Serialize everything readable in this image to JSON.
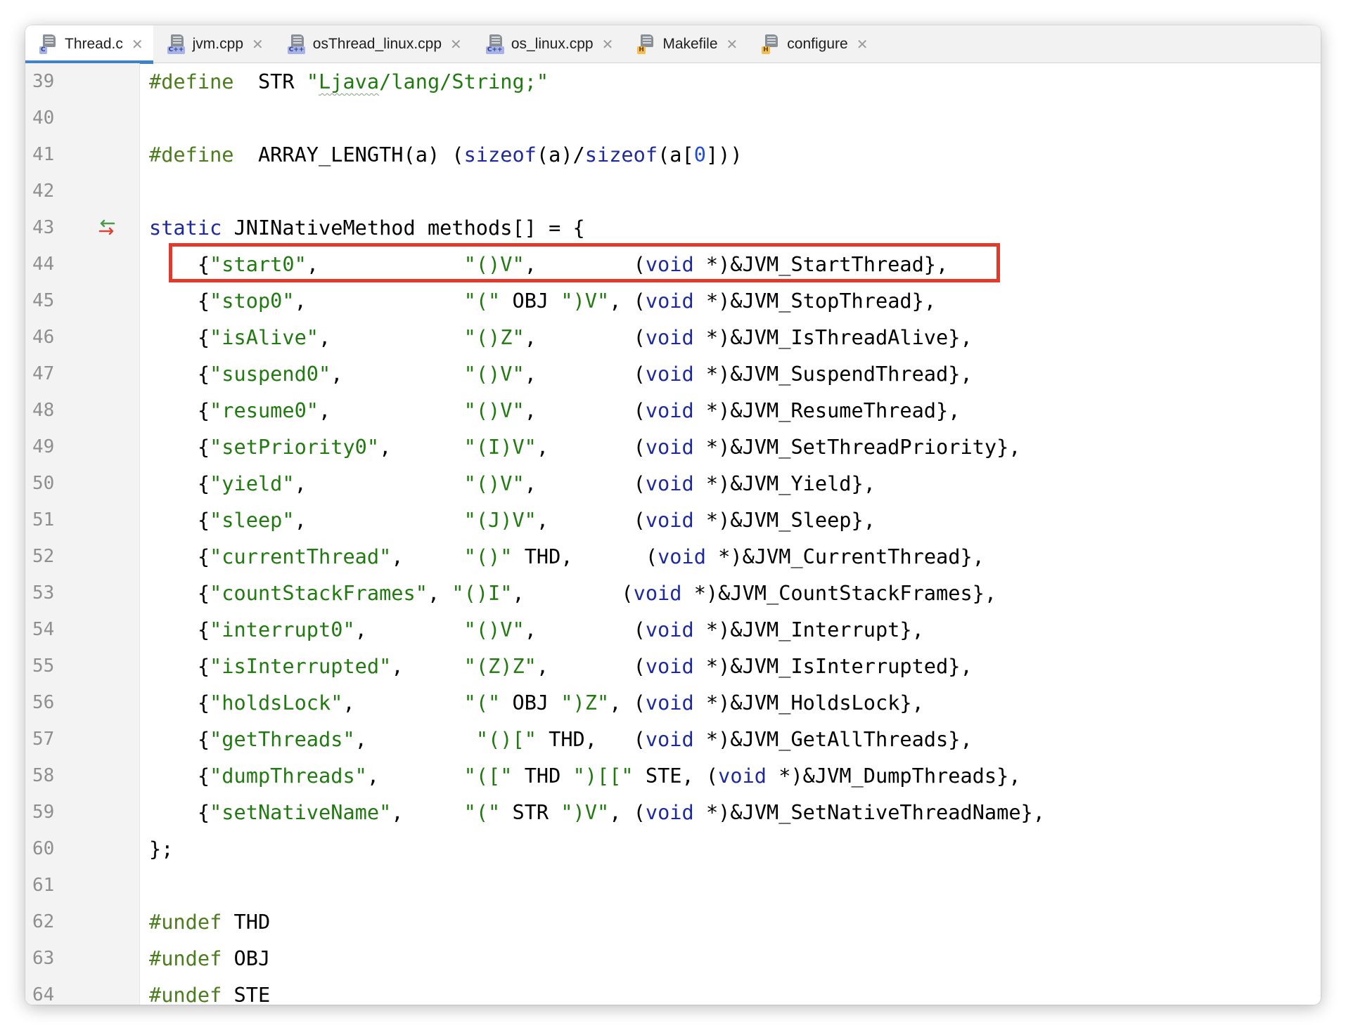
{
  "tabs": [
    {
      "label": "Thread.c",
      "icon": "c-file-icon",
      "badge": "C",
      "kind": "c",
      "active": true
    },
    {
      "label": "jvm.cpp",
      "icon": "cpp-file-icon",
      "badge": "C++",
      "kind": "cpp",
      "active": false
    },
    {
      "label": "osThread_linux.cpp",
      "icon": "cpp-file-icon",
      "badge": "C++",
      "kind": "cpp",
      "active": false
    },
    {
      "label": "os_linux.cpp",
      "icon": "cpp-file-icon",
      "badge": "C++",
      "kind": "cpp",
      "active": false
    },
    {
      "label": "Makefile",
      "icon": "h-file-icon",
      "badge": "H",
      "kind": "h",
      "active": false
    },
    {
      "label": "configure",
      "icon": "h-file-icon",
      "badge": "H",
      "kind": "h",
      "active": false
    }
  ],
  "close_glyph": "✕",
  "highlighted_line": 44,
  "colors": {
    "accent_tab": "#4083c9",
    "highlight_box": "#e13a2d",
    "preprocessor": "#4a7d1b",
    "string": "#207a10",
    "keyword": "#1d2a9e",
    "number": "#1f4fd8"
  },
  "lines": [
    {
      "n": "39",
      "tokens": [
        [
          "pre",
          "#define"
        ],
        [
          "",
          "  STR "
        ],
        [
          "str",
          "\""
        ],
        [
          "str sq",
          "Ljava"
        ],
        [
          "str",
          "/lang/String;\""
        ]
      ]
    },
    {
      "n": "40",
      "tokens": []
    },
    {
      "n": "41",
      "tokens": [
        [
          "pre",
          "#define"
        ],
        [
          "",
          "  ARRAY_LENGTH(a) ("
        ],
        [
          "kw",
          "sizeof"
        ],
        [
          "",
          "(a)/"
        ],
        [
          "kw",
          "sizeof"
        ],
        [
          "",
          "(a["
        ],
        [
          "num",
          "0"
        ],
        [
          "",
          "]))"
        ]
      ]
    },
    {
      "n": "42",
      "tokens": []
    },
    {
      "n": "43",
      "marker": "override-arrows-icon",
      "tokens": [
        [
          "kw",
          "static"
        ],
        [
          "",
          " JNINativeMethod methods[] = {"
        ]
      ]
    },
    {
      "n": "44",
      "tokens": [
        [
          "",
          "    {"
        ],
        [
          "str",
          "\"start0\""
        ],
        [
          "",
          ",            "
        ],
        [
          "str",
          "\"()V\""
        ],
        [
          "",
          ",        ("
        ],
        [
          "kw",
          "void"
        ],
        [
          "",
          " *)&JVM_StartThread},"
        ]
      ]
    },
    {
      "n": "45",
      "tokens": [
        [
          "",
          "    {"
        ],
        [
          "str",
          "\"stop0\""
        ],
        [
          "",
          ",             "
        ],
        [
          "str",
          "\"(\""
        ],
        [
          "",
          " OBJ "
        ],
        [
          "str",
          "\")V\""
        ],
        [
          "",
          ", ("
        ],
        [
          "kw",
          "void"
        ],
        [
          "",
          " *)&JVM_StopThread},"
        ]
      ]
    },
    {
      "n": "46",
      "tokens": [
        [
          "",
          "    {"
        ],
        [
          "str",
          "\"isAlive\""
        ],
        [
          "",
          ",           "
        ],
        [
          "str",
          "\"()Z\""
        ],
        [
          "",
          ",        ("
        ],
        [
          "kw",
          "void"
        ],
        [
          "",
          " *)&JVM_IsThreadAlive},"
        ]
      ]
    },
    {
      "n": "47",
      "tokens": [
        [
          "",
          "    {"
        ],
        [
          "str",
          "\"suspend0\""
        ],
        [
          "",
          ",          "
        ],
        [
          "str",
          "\"()V\""
        ],
        [
          "",
          ",        ("
        ],
        [
          "kw",
          "void"
        ],
        [
          "",
          " *)&JVM_SuspendThread},"
        ]
      ]
    },
    {
      "n": "48",
      "tokens": [
        [
          "",
          "    {"
        ],
        [
          "str",
          "\"resume0\""
        ],
        [
          "",
          ",           "
        ],
        [
          "str",
          "\"()V\""
        ],
        [
          "",
          ",        ("
        ],
        [
          "kw",
          "void"
        ],
        [
          "",
          " *)&JVM_ResumeThread},"
        ]
      ]
    },
    {
      "n": "49",
      "tokens": [
        [
          "",
          "    {"
        ],
        [
          "str",
          "\"setPriority0\""
        ],
        [
          "",
          ",      "
        ],
        [
          "str",
          "\"(I)V\""
        ],
        [
          "",
          ",       ("
        ],
        [
          "kw",
          "void"
        ],
        [
          "",
          " *)&JVM_SetThreadPriority},"
        ]
      ]
    },
    {
      "n": "50",
      "tokens": [
        [
          "",
          "    {"
        ],
        [
          "str",
          "\"yield\""
        ],
        [
          "",
          ",             "
        ],
        [
          "str",
          "\"()V\""
        ],
        [
          "",
          ",        ("
        ],
        [
          "kw",
          "void"
        ],
        [
          "",
          " *)&JVM_Yield},"
        ]
      ]
    },
    {
      "n": "51",
      "tokens": [
        [
          "",
          "    {"
        ],
        [
          "str",
          "\"sleep\""
        ],
        [
          "",
          ",             "
        ],
        [
          "str",
          "\"(J)V\""
        ],
        [
          "",
          ",       ("
        ],
        [
          "kw",
          "void"
        ],
        [
          "",
          " *)&JVM_Sleep},"
        ]
      ]
    },
    {
      "n": "52",
      "tokens": [
        [
          "",
          "    {"
        ],
        [
          "str",
          "\"currentThread\""
        ],
        [
          "",
          ",     "
        ],
        [
          "str",
          "\"()\""
        ],
        [
          "",
          " THD,      ("
        ],
        [
          "kw",
          "void"
        ],
        [
          "",
          " *)&JVM_CurrentThread},"
        ]
      ]
    },
    {
      "n": "53",
      "tokens": [
        [
          "",
          "    {"
        ],
        [
          "str",
          "\"countStackFrames\""
        ],
        [
          "",
          ", "
        ],
        [
          "str",
          "\"()I\""
        ],
        [
          "",
          ",        ("
        ],
        [
          "kw",
          "void"
        ],
        [
          "",
          " *)&JVM_CountStackFrames},"
        ]
      ]
    },
    {
      "n": "54",
      "tokens": [
        [
          "",
          "    {"
        ],
        [
          "str",
          "\"interrupt0\""
        ],
        [
          "",
          ",        "
        ],
        [
          "str",
          "\"()V\""
        ],
        [
          "",
          ",        ("
        ],
        [
          "kw",
          "void"
        ],
        [
          "",
          " *)&JVM_Interrupt},"
        ]
      ]
    },
    {
      "n": "55",
      "tokens": [
        [
          "",
          "    {"
        ],
        [
          "str",
          "\"isInterrupted\""
        ],
        [
          "",
          ",     "
        ],
        [
          "str",
          "\"(Z)Z\""
        ],
        [
          "",
          ",       ("
        ],
        [
          "kw",
          "void"
        ],
        [
          "",
          " *)&JVM_IsInterrupted},"
        ]
      ]
    },
    {
      "n": "56",
      "tokens": [
        [
          "",
          "    {"
        ],
        [
          "str",
          "\"holdsLock\""
        ],
        [
          "",
          ",         "
        ],
        [
          "str",
          "\"(\""
        ],
        [
          "",
          " OBJ "
        ],
        [
          "str",
          "\")Z\""
        ],
        [
          "",
          ", ("
        ],
        [
          "kw",
          "void"
        ],
        [
          "",
          " *)&JVM_HoldsLock},"
        ]
      ]
    },
    {
      "n": "57",
      "tokens": [
        [
          "",
          "    {"
        ],
        [
          "str",
          "\"getThreads\""
        ],
        [
          "",
          ",         "
        ],
        [
          "str",
          "\"()[\""
        ],
        [
          "",
          " THD,   ("
        ],
        [
          "kw",
          "void"
        ],
        [
          "",
          " *)&JVM_GetAllThreads},"
        ]
      ]
    },
    {
      "n": "58",
      "tokens": [
        [
          "",
          "    {"
        ],
        [
          "str",
          "\"dumpThreads\""
        ],
        [
          "",
          ",       "
        ],
        [
          "str",
          "\"([\""
        ],
        [
          "",
          " THD "
        ],
        [
          "str",
          "\")[[\""
        ],
        [
          "",
          " STE, ("
        ],
        [
          "kw",
          "void"
        ],
        [
          "",
          " *)&JVM_DumpThreads},"
        ]
      ]
    },
    {
      "n": "59",
      "tokens": [
        [
          "",
          "    {"
        ],
        [
          "str",
          "\"setNativeName\""
        ],
        [
          "",
          ",     "
        ],
        [
          "str",
          "\"(\""
        ],
        [
          "",
          " STR "
        ],
        [
          "str",
          "\")V\""
        ],
        [
          "",
          ", ("
        ],
        [
          "kw",
          "void"
        ],
        [
          "",
          " *)&JVM_SetNativeThreadName},"
        ]
      ]
    },
    {
      "n": "60",
      "tokens": [
        [
          "",
          "};"
        ]
      ]
    },
    {
      "n": "61",
      "tokens": []
    },
    {
      "n": "62",
      "tokens": [
        [
          "pre",
          "#undef"
        ],
        [
          "",
          " THD"
        ]
      ]
    },
    {
      "n": "63",
      "tokens": [
        [
          "pre",
          "#undef"
        ],
        [
          "",
          " OBJ"
        ]
      ]
    },
    {
      "n": "64",
      "tokens": [
        [
          "pre",
          "#undef"
        ],
        [
          "",
          " STE"
        ]
      ]
    }
  ]
}
